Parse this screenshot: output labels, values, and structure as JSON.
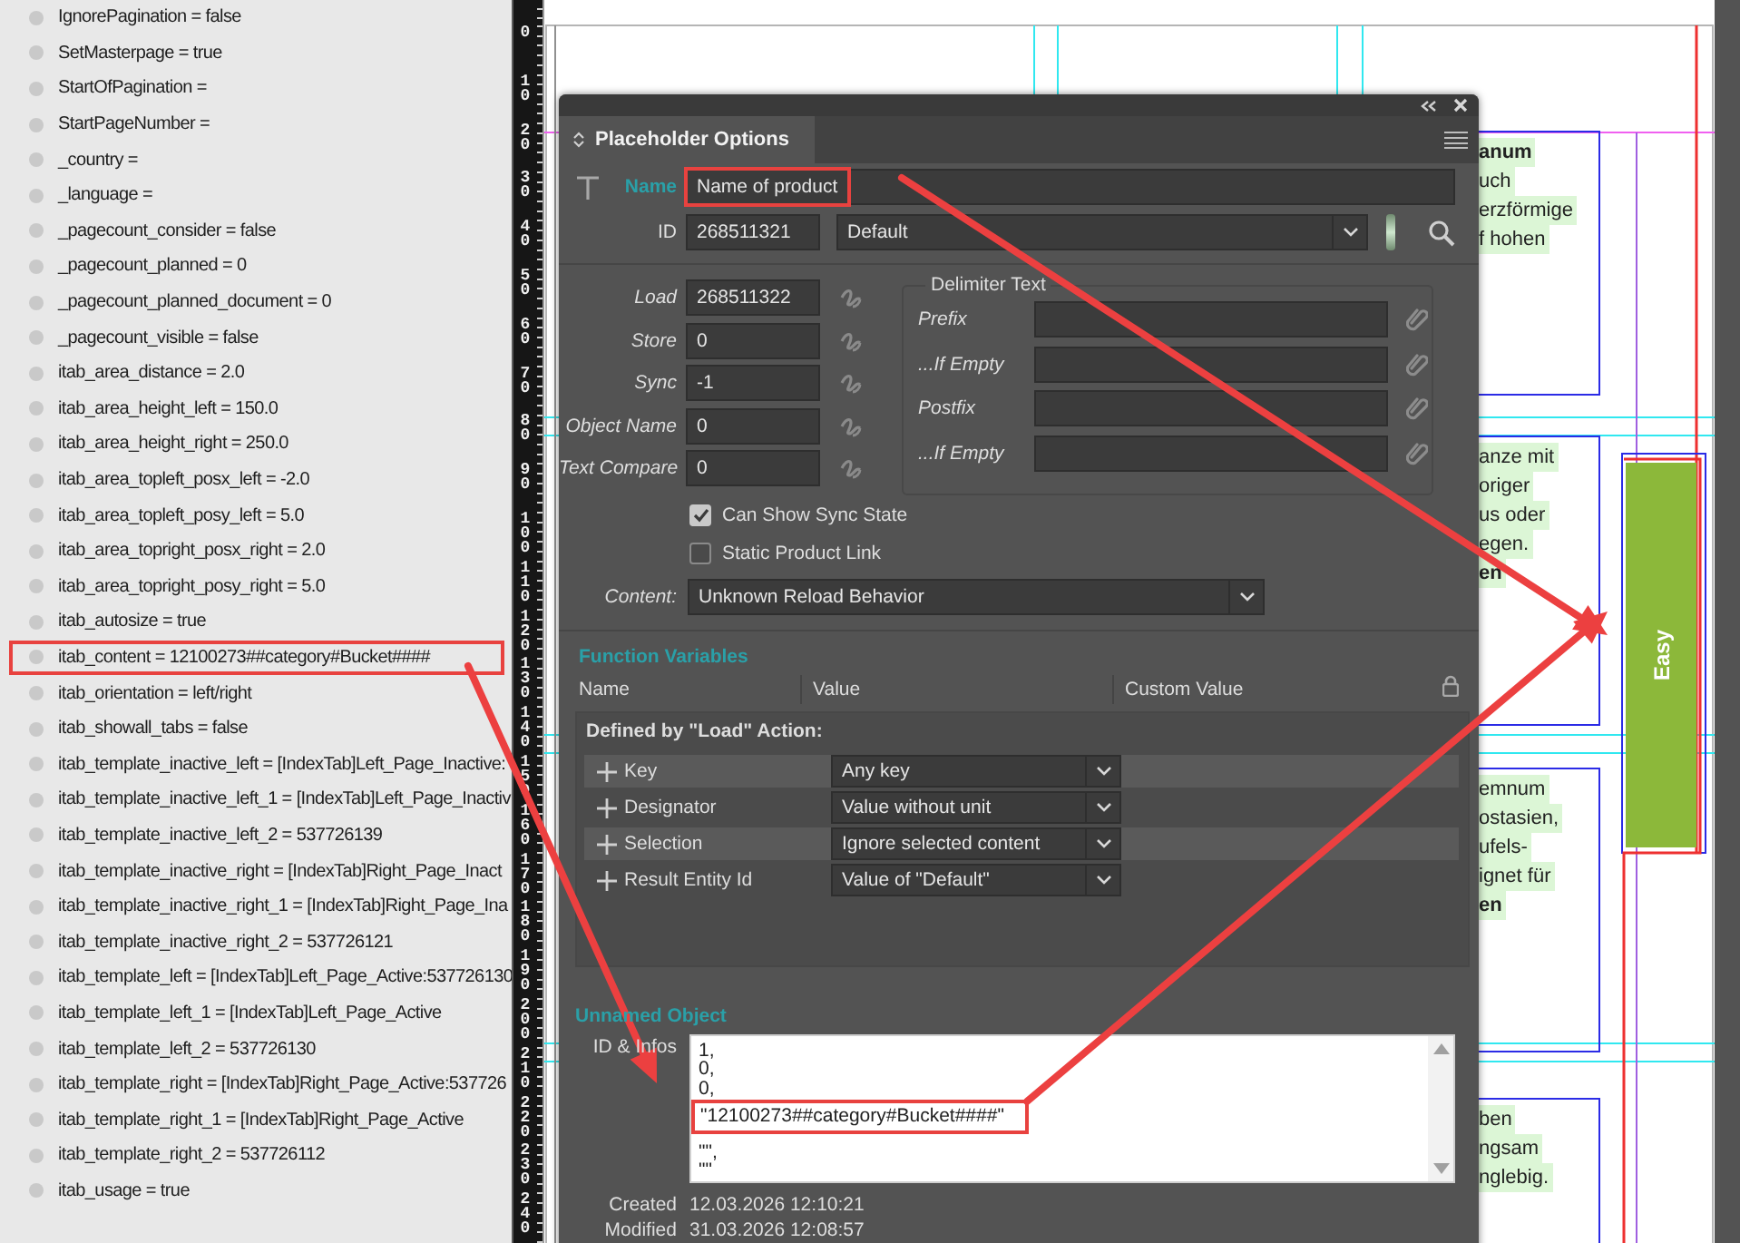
{
  "left_panel": {
    "items": [
      {
        "text": "IgnorePagination = false",
        "annotated": false
      },
      {
        "text": "SetMasterpage = true",
        "annotated": false
      },
      {
        "text": "StartOfPagination =",
        "annotated": false
      },
      {
        "text": "StartPageNumber =",
        "annotated": false
      },
      {
        "text": "_country =",
        "annotated": false
      },
      {
        "text": "_language =",
        "annotated": false
      },
      {
        "text": "_pagecount_consider = false",
        "annotated": false
      },
      {
        "text": "_pagecount_planned = 0",
        "annotated": false
      },
      {
        "text": "_pagecount_planned_document = 0",
        "annotated": false
      },
      {
        "text": "_pagecount_visible = false",
        "annotated": false
      },
      {
        "text": "itab_area_distance = 2.0",
        "annotated": false
      },
      {
        "text": "itab_area_height_left = 150.0",
        "annotated": false
      },
      {
        "text": "itab_area_height_right = 250.0",
        "annotated": false
      },
      {
        "text": "itab_area_topleft_posx_left = -2.0",
        "annotated": false
      },
      {
        "text": "itab_area_topleft_posy_left = 5.0",
        "annotated": false
      },
      {
        "text": "itab_area_topright_posx_right = 2.0",
        "annotated": false
      },
      {
        "text": "itab_area_topright_posy_right = 5.0",
        "annotated": false
      },
      {
        "text": "itab_autosize = true",
        "annotated": false
      },
      {
        "text": "itab_content = 12100273##category#Bucket####",
        "annotated": true
      },
      {
        "text": "itab_orientation = left/right",
        "annotated": false
      },
      {
        "text": "itab_showall_tabs = false",
        "annotated": false
      },
      {
        "text": "itab_template_inactive_left = [IndexTab]Left_Page_Inactive:",
        "annotated": false
      },
      {
        "text": "itab_template_inactive_left_1 = [IndexTab]Left_Page_Inactiv",
        "annotated": false
      },
      {
        "text": "itab_template_inactive_left_2 = 537726139",
        "annotated": false
      },
      {
        "text": "itab_template_inactive_right = [IndexTab]Right_Page_Inact",
        "annotated": false
      },
      {
        "text": "itab_template_inactive_right_1 = [IndexTab]Right_Page_Ina",
        "annotated": false
      },
      {
        "text": "itab_template_inactive_right_2 = 537726121",
        "annotated": false
      },
      {
        "text": "itab_template_left = [IndexTab]Left_Page_Active:537726130",
        "annotated": false
      },
      {
        "text": "itab_template_left_1 = [IndexTab]Left_Page_Active",
        "annotated": false
      },
      {
        "text": "itab_template_left_2 = 537726130",
        "annotated": false
      },
      {
        "text": "itab_template_right = [IndexTab]Right_Page_Active:537726",
        "annotated": false
      },
      {
        "text": "itab_template_right_1 = [IndexTab]Right_Page_Active",
        "annotated": false
      },
      {
        "text": "itab_template_right_2 = 537726112",
        "annotated": false
      },
      {
        "text": "itab_usage = true",
        "annotated": false
      }
    ]
  },
  "ruler": {
    "labels": [
      "0",
      "10",
      "20",
      "30",
      "40",
      "50",
      "60",
      "70",
      "80",
      "90",
      "100",
      "110",
      "120",
      "130",
      "140",
      "150",
      "160",
      "170",
      "180",
      "190",
      "200",
      "210",
      "220",
      "230",
      "240"
    ]
  },
  "palette": {
    "tab": "Placeholder Options",
    "name": {
      "label": "Name",
      "value": "Name of product",
      "annotated": true
    },
    "id": {
      "label": "ID",
      "value": "268511321",
      "select": "Default"
    },
    "fields": [
      {
        "label": "Load",
        "value": "268511322"
      },
      {
        "label": "Store",
        "value": "0"
      },
      {
        "label": "Sync",
        "value": "-1"
      },
      {
        "label": "Object Name",
        "value": "0"
      },
      {
        "label": "Text Compare",
        "value": "0"
      }
    ],
    "delimiter": {
      "title": "Delimiter Text",
      "fields": [
        {
          "label": "Prefix"
        },
        {
          "label": "...If Empty"
        },
        {
          "label": "Postfix"
        },
        {
          "label": "...If Empty"
        }
      ]
    },
    "checkboxes": [
      {
        "label": "Can Show Sync State",
        "checked": true
      },
      {
        "label": "Static Product Link",
        "checked": false
      }
    ],
    "content": {
      "label": "Content:",
      "value": "Unknown Reload Behavior"
    },
    "function_variables": {
      "title": "Function Variables",
      "columns": [
        "Name",
        "Value",
        "Custom Value"
      ],
      "group": "Defined by \"Load\" Action:",
      "rows": [
        {
          "name": "Key",
          "value": "Any key"
        },
        {
          "name": "Designator",
          "value": "Value without unit"
        },
        {
          "name": "Selection",
          "value": "Ignore selected content"
        },
        {
          "name": "Result Entity Id",
          "value": "Value of \"Default\""
        }
      ]
    },
    "object": {
      "title": "Unnamed Object",
      "infos_label": "ID & Infos",
      "infos_lines": [
        {
          "text": "1,",
          "annotated": false
        },
        {
          "text": "0,",
          "annotated": false
        },
        {
          "text": "0,",
          "annotated": false
        },
        {
          "text": "\"12100273##category#Bucket####\"",
          "annotated": true
        },
        {
          "text": "\"\",",
          "annotated": false
        },
        {
          "text": "\"\"",
          "annotated": false
        }
      ],
      "created_label": "Created",
      "created": "12.03.2026 12:10:21",
      "modified_label": "Modified",
      "modified": "31.03.2026 12:08:57"
    }
  },
  "document": {
    "frames": [
      {
        "lines": [
          {
            "text": "anum",
            "bold": true
          },
          {
            "text": "uch",
            "bold": false
          },
          {
            "text": "erzförmige",
            "bold": false
          },
          {
            "text": "f hohen",
            "bold": false
          }
        ]
      },
      {
        "lines": [
          {
            "text": "anze mit",
            "bold": false
          },
          {
            "text": "origer",
            "bold": false
          },
          {
            "text": "us oder",
            "bold": false
          },
          {
            "text": "egen.",
            "bold": false
          },
          {
            "text": "en",
            "bold": true
          }
        ]
      },
      {
        "lines": [
          {
            "text": "emnum",
            "bold": false
          },
          {
            "text": "ostasien,",
            "bold": false
          },
          {
            "text": "ufels-",
            "bold": false
          },
          {
            "text": "ignet für",
            "bold": false
          },
          {
            "text": "en",
            "bold": true
          }
        ]
      },
      {
        "lines": [
          {
            "text": "ben",
            "bold": false
          },
          {
            "text": "ngsam",
            "bold": false
          },
          {
            "text": "nglebig.",
            "bold": false
          }
        ]
      }
    ],
    "index_tab": {
      "text": "Easy"
    }
  }
}
